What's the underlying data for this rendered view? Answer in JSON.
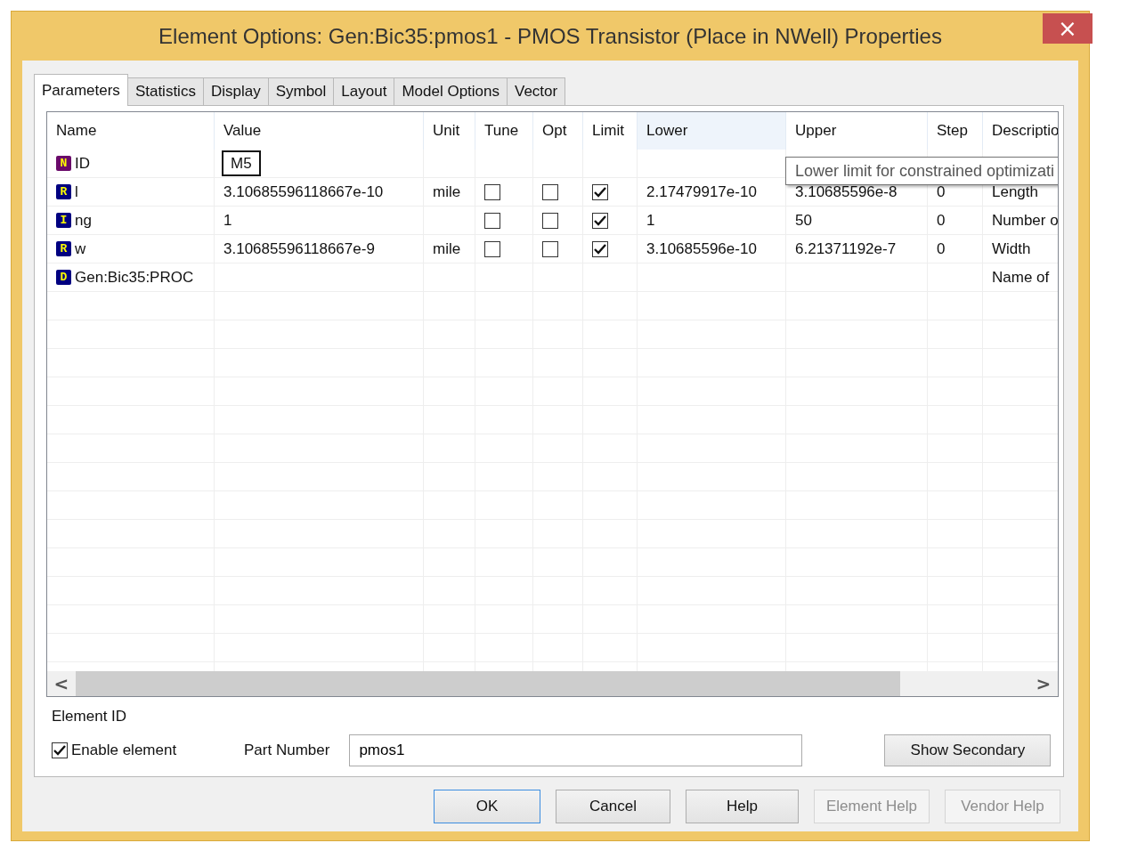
{
  "window": {
    "title": "Element Options: Gen:Bic35:pmos1 - PMOS Transistor (Place in NWell) Properties",
    "close": "×"
  },
  "tabs": [
    {
      "label": "Parameters",
      "selected": true
    },
    {
      "label": "Statistics",
      "selected": false
    },
    {
      "label": "Display",
      "selected": false
    },
    {
      "label": "Symbol",
      "selected": false
    },
    {
      "label": "Layout",
      "selected": false
    },
    {
      "label": "Model Options",
      "selected": false
    },
    {
      "label": "Vector",
      "selected": false
    }
  ],
  "table": {
    "columns": [
      {
        "label": "Name",
        "highlighted": false
      },
      {
        "label": "Value",
        "highlighted": false
      },
      {
        "label": "Unit",
        "highlighted": false
      },
      {
        "label": "Tune",
        "highlighted": false
      },
      {
        "label": "Opt",
        "highlighted": false
      },
      {
        "label": "Limit",
        "highlighted": false
      },
      {
        "label": "Lower",
        "highlighted": true
      },
      {
        "label": "Upper",
        "highlighted": false
      },
      {
        "label": "Step",
        "highlighted": false
      },
      {
        "label": "Descriptio",
        "highlighted": false
      }
    ],
    "rows": [
      {
        "badge": "N",
        "color": "#6a0a6a",
        "name": "ID",
        "value": "M5",
        "editing": true
      },
      {
        "badge": "R",
        "color": "#000080",
        "name": "l",
        "value": "3.10685596118667e-10",
        "editing": false,
        "unit": "mile",
        "tune": false,
        "opt": false,
        "limit": true,
        "lower": "2.17479917e-10",
        "upper": "3.10685596e-8",
        "step": "0",
        "description": "Length"
      },
      {
        "badge": "I",
        "color": "#000080",
        "name": "ng",
        "value": "1",
        "editing": false,
        "tune": false,
        "opt": false,
        "limit": true,
        "lower": "1",
        "upper": "50",
        "step": "0",
        "description": "Number o"
      },
      {
        "badge": "R",
        "color": "#000080",
        "name": "w",
        "value": "3.10685596118667e-9",
        "editing": false,
        "unit": "mile",
        "tune": false,
        "opt": false,
        "limit": true,
        "lower": "3.10685596e-10",
        "upper": "6.21371192e-7",
        "step": "0",
        "description": "Width"
      },
      {
        "badge": "D",
        "color": "#000080",
        "name": "Gen:Bic35:PROC",
        "editing": false,
        "description": "Name of"
      }
    ],
    "tooltip": "Lower limit for constrained optimizati",
    "scroll_left": "<",
    "scroll_right": ">"
  },
  "element_id": {
    "label": "Element ID",
    "enable_label": "Enable element",
    "enabled": true,
    "part_number_label": "Part Number",
    "part_number": "pmos1",
    "show_secondary": "Show Secondary"
  },
  "buttons": [
    {
      "label": "OK",
      "default": true,
      "disabled": false
    },
    {
      "label": "Cancel",
      "default": false,
      "disabled": false
    },
    {
      "label": "Help",
      "default": false,
      "disabled": false
    },
    {
      "label": "Element Help",
      "default": false,
      "disabled": true
    },
    {
      "label": "Vendor Help",
      "default": false,
      "disabled": true
    }
  ]
}
